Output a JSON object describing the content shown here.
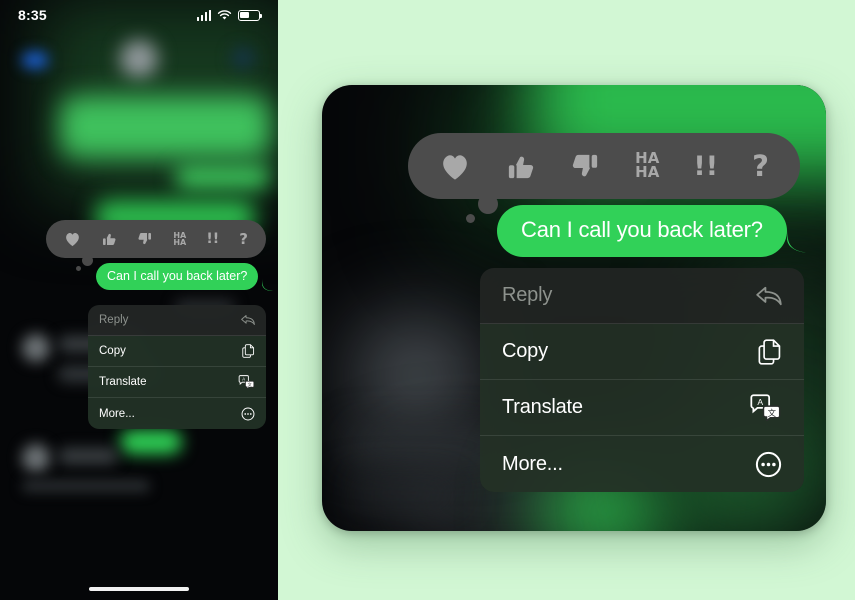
{
  "background_color": "#d2f7d4",
  "phone": {
    "status_bar": {
      "time": "8:35",
      "signal_icon": "cellular-signal-icon",
      "wifi_icon": "wifi-icon",
      "battery_icon": "battery-icon"
    },
    "message": {
      "text": "Can I call you back later?",
      "bubble_color": "#31d158",
      "text_color": "#ffffff"
    },
    "reaction_bar": {
      "background_color": "#4a4a4a",
      "icon_color": "#a9a9a9",
      "reactions": [
        {
          "name": "heart-reaction",
          "label": "heart"
        },
        {
          "name": "thumbs-up-reaction",
          "label": "thumbs-up"
        },
        {
          "name": "thumbs-down-reaction",
          "label": "thumbs-down"
        },
        {
          "name": "haha-reaction",
          "label": "HA HA",
          "line1": "HA",
          "line2": "HA"
        },
        {
          "name": "exclamation-reaction",
          "label": "!!"
        },
        {
          "name": "question-reaction",
          "label": "?"
        }
      ]
    },
    "context_menu": {
      "items": [
        {
          "label": "Reply",
          "icon": "reply-arrow-icon",
          "dimmed": true
        },
        {
          "label": "Copy",
          "icon": "copy-pages-icon",
          "dimmed": false
        },
        {
          "label": "Translate",
          "icon": "translate-icon",
          "dimmed": false
        },
        {
          "label": "More...",
          "icon": "more-circle-icon",
          "dimmed": false
        }
      ]
    },
    "home_indicator": "home-indicator"
  },
  "zoom_panel": {
    "message": {
      "text": "Can I call you back later?",
      "bubble_color": "#31d158",
      "text_color": "#ffffff"
    },
    "reaction_bar": {
      "background_color": "#4c4c4c",
      "icon_color": "#a8a8a8",
      "reactions": [
        {
          "name": "heart-reaction",
          "label": "heart"
        },
        {
          "name": "thumbs-up-reaction",
          "label": "thumbs-up"
        },
        {
          "name": "thumbs-down-reaction",
          "label": "thumbs-down"
        },
        {
          "name": "haha-reaction",
          "label": "HA HA",
          "line1": "HA",
          "line2": "HA"
        },
        {
          "name": "exclamation-reaction",
          "label": "!!"
        },
        {
          "name": "question-reaction",
          "label": "?"
        }
      ]
    },
    "context_menu": {
      "items": [
        {
          "label": "Reply",
          "icon": "reply-arrow-icon",
          "dimmed": true
        },
        {
          "label": "Copy",
          "icon": "copy-pages-icon",
          "dimmed": false
        },
        {
          "label": "Translate",
          "icon": "translate-icon",
          "dimmed": false
        },
        {
          "label": "More...",
          "icon": "more-circle-icon",
          "dimmed": false
        }
      ]
    }
  }
}
